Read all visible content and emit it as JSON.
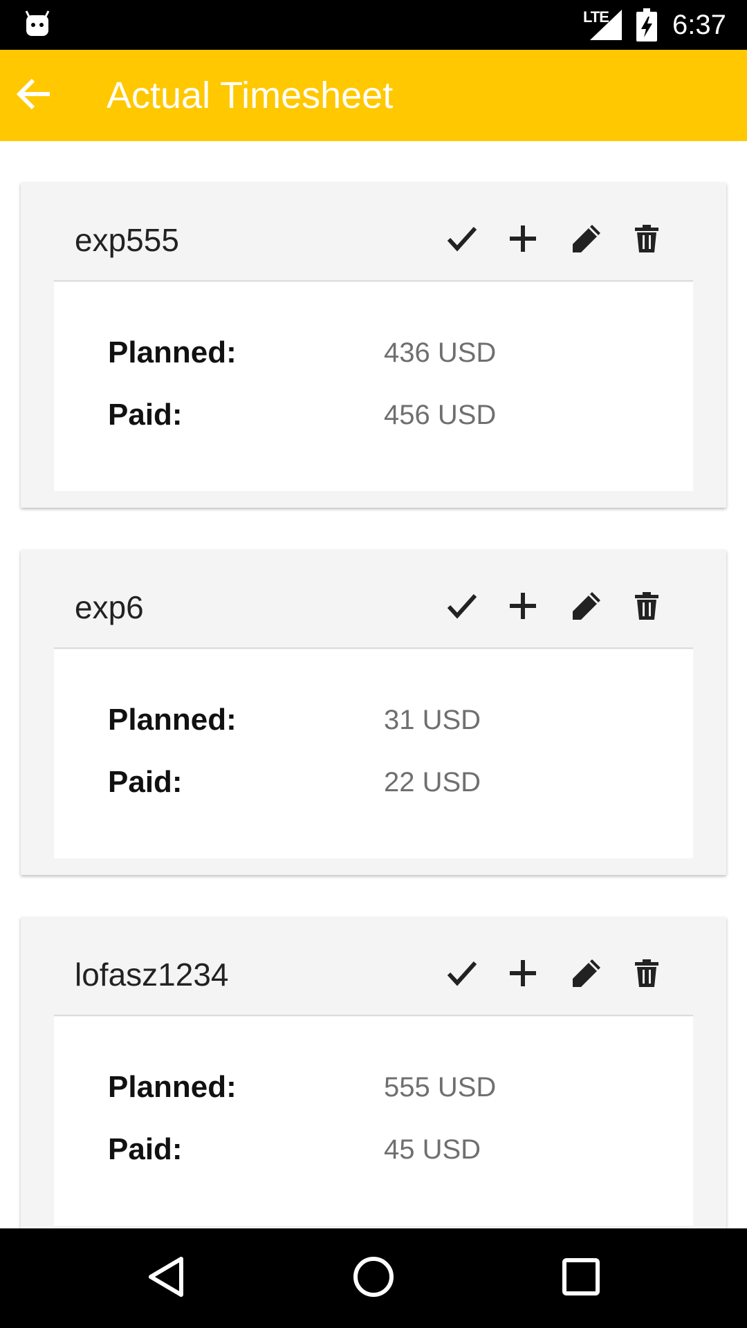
{
  "status_bar": {
    "network": "LTE",
    "time": "6:37",
    "icons": [
      "android-notification-icon",
      "signal-icon",
      "battery-charging-icon"
    ]
  },
  "app_bar": {
    "title": "Actual Timesheet",
    "back_icon": "arrow-back-icon"
  },
  "colors": {
    "app_bar": "#FFC800",
    "card_bg": "#f4f4f4",
    "label": "#111111",
    "value": "#6f6f6f"
  },
  "cards": [
    {
      "title": "exp555",
      "rows": [
        {
          "label": "Planned:",
          "value": "436 USD"
        },
        {
          "label": "Paid:",
          "value": "456 USD"
        }
      ]
    },
    {
      "title": "exp6",
      "rows": [
        {
          "label": "Planned:",
          "value": "31 USD"
        },
        {
          "label": "Paid:",
          "value": "22 USD"
        }
      ]
    },
    {
      "title": "lofasz1234",
      "rows": [
        {
          "label": "Planned:",
          "value": "555 USD"
        },
        {
          "label": "Paid:",
          "value": "45 USD"
        }
      ]
    }
  ],
  "card_actions": [
    "check-icon",
    "plus-icon",
    "pencil-icon",
    "trash-icon"
  ],
  "nav_bar": [
    "back-triangle-icon",
    "home-circle-icon",
    "recents-square-icon"
  ]
}
